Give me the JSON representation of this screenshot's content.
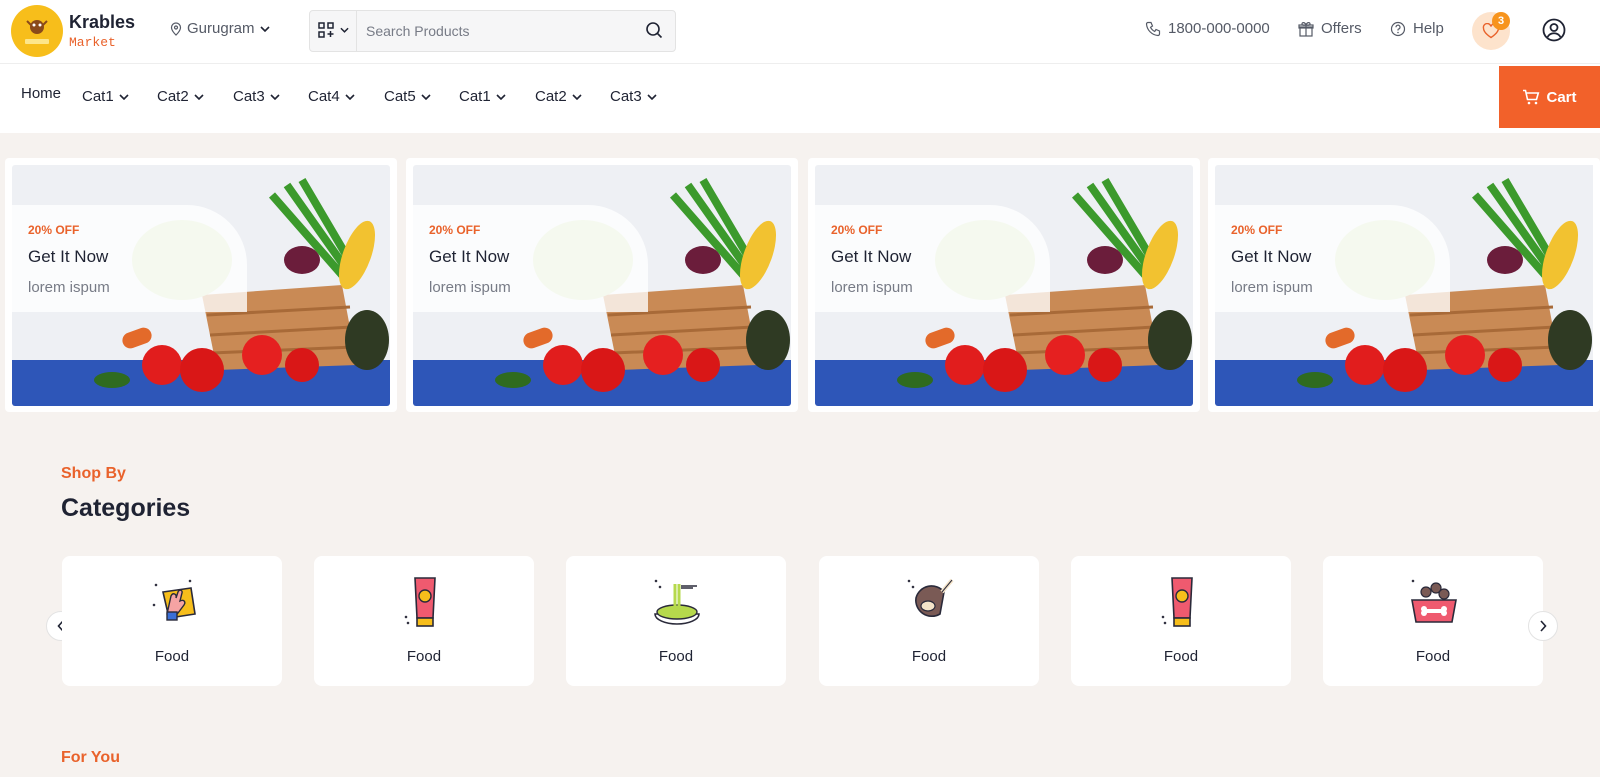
{
  "brand": {
    "name": "Krables",
    "sub": "Market",
    "logo_text": "KRABLES"
  },
  "header": {
    "location": "Gurugram",
    "search_placeholder": "Search Products",
    "phone": "1800-000-0000",
    "offers": "Offers",
    "help": "Help",
    "wishlist_count": "3"
  },
  "nav": {
    "items": [
      "Home",
      "Cat1",
      "Cat2",
      "Cat3",
      "Cat4",
      "Cat5",
      "Cat1",
      "Cat2",
      "Cat3"
    ],
    "cart": "Cart"
  },
  "banners": [
    {
      "off": "20% OFF",
      "title": "Get It Now",
      "sub": "lorem ispum"
    },
    {
      "off": "20% OFF",
      "title": "Get It Now",
      "sub": "lorem ispum"
    },
    {
      "off": "20% OFF",
      "title": "Get It Now",
      "sub": "lorem ispum"
    },
    {
      "off": "20% OFF",
      "title": "Get It Now",
      "sub": "lorem ispum"
    }
  ],
  "categories": {
    "eyebrow": "Shop By",
    "heading": "Categories",
    "items": [
      {
        "label": "Food",
        "icon": "cleaning-cloth-icon"
      },
      {
        "label": "Food",
        "icon": "lotion-tube-icon"
      },
      {
        "label": "Food",
        "icon": "noodles-icon"
      },
      {
        "label": "Food",
        "icon": "meat-icon"
      },
      {
        "label": "Food",
        "icon": "lotion-tube-icon"
      },
      {
        "label": "Food",
        "icon": "pet-food-icon"
      }
    ]
  },
  "for_you": "For You",
  "colors": {
    "accent": "#e9622b",
    "cart": "#f2612a",
    "brand_yellow": "#f7be1b"
  }
}
